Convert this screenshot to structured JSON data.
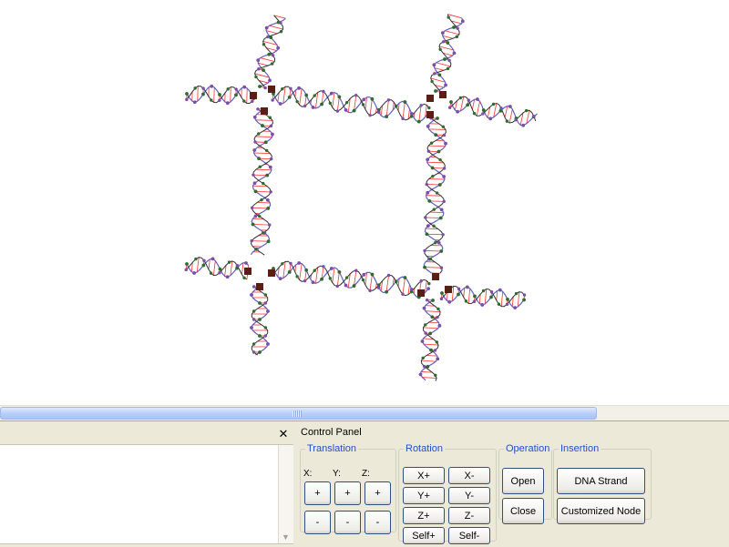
{
  "viewport": {
    "description_labels": []
  },
  "left_panel": {
    "close_glyph": "✕",
    "scroll_down_glyph": "▼"
  },
  "control_panel": {
    "title": "Control Panel",
    "translation": {
      "legend": "Translation",
      "axes": [
        "X:",
        "Y:",
        "Z:"
      ],
      "plus": "+",
      "minus": "-"
    },
    "rotation": {
      "legend": "Rotation",
      "buttons": [
        "X+",
        "X-",
        "Y+",
        "Y-",
        "Z+",
        "Z-",
        "Self+",
        "Self-"
      ]
    },
    "operation": {
      "legend": "Operation",
      "open": "Open",
      "close": "Close"
    },
    "insertion": {
      "legend": "Insertion",
      "dna_strand": "DNA Strand",
      "customized_node": "Customized Node"
    }
  },
  "colors": {
    "backbone": "#6060c0",
    "base_pair": "#ff3030",
    "atom_dark": "#2e6b2e",
    "atom_purple": "#7a4fa8",
    "node": "#5a1f14",
    "scroll_thumb": "#b7cdf9",
    "legend_blue": "#1f4fcf"
  },
  "icons": [
    "close-icon",
    "scroll-down-arrow-icon",
    "scroll-grip-icon"
  ]
}
